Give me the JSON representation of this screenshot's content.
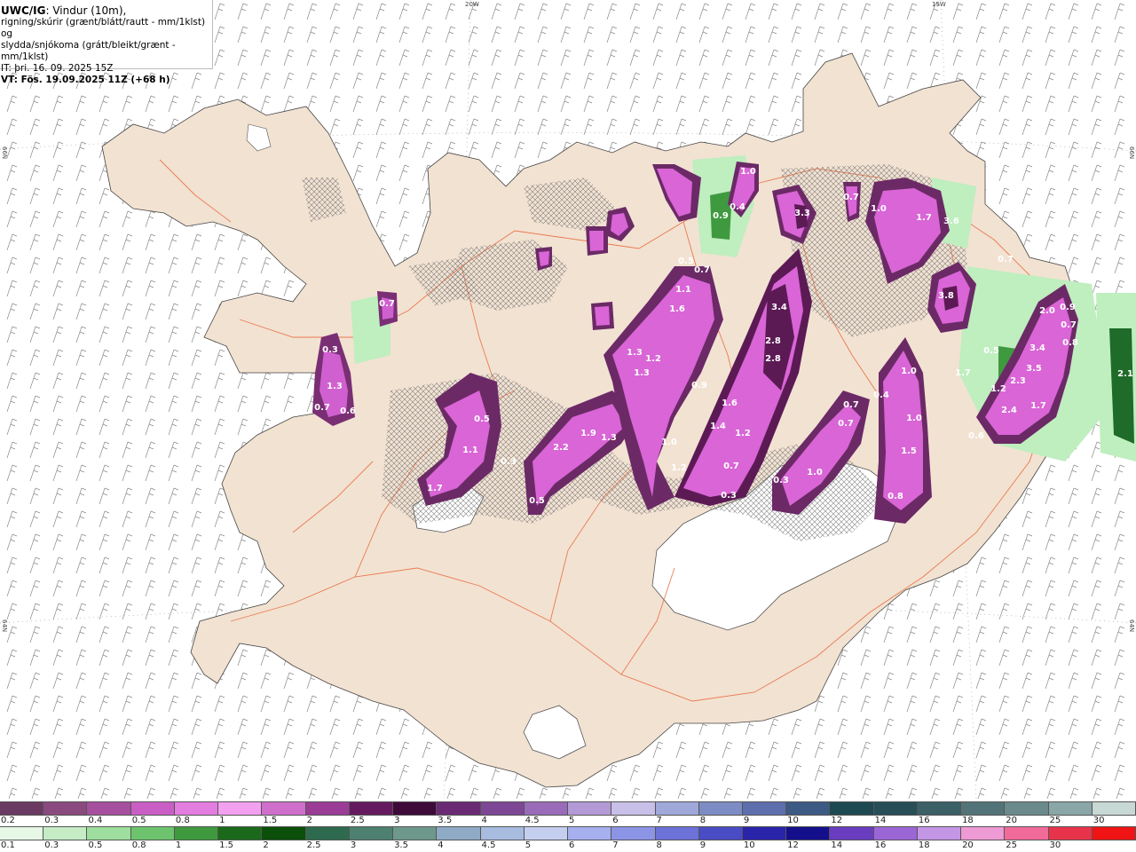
{
  "title": {
    "line1_bold": "UWC/IG",
    "line1_rest": ": Vindur (10m),",
    "line2": "rigning/skúrir (grænt/blátt/rautt - mm/1klst) og",
    "line3": "slydda/snjókoma (grátt/bleikt/grænt - mm/1klst)",
    "line4": "IT: þri. 16. 09. 2025 15Z",
    "line5": "VT: Fös. 19.09.2025 11Z (+68 h)"
  },
  "coords": {
    "top_left": "20W",
    "top_right": "15W",
    "left_upper": "66N",
    "left_lower": "64N",
    "right_upper": "66N",
    "right_lower": "64N"
  },
  "colors": {
    "land": "#f2e2d2",
    "sea": "#ffffff",
    "roads": "#e8683a",
    "glacier": "#ffffff",
    "snow_dark": "#5c1a55",
    "snow_mid": "#b540b0",
    "snow_light": "#ee88ee",
    "rain_green": "#a8e8a8",
    "rain_dark_green": "#1f6b2a"
  },
  "precip_values": [
    {
      "label": "0.7"
    },
    {
      "label": "0.3"
    },
    {
      "label": "1.3"
    },
    {
      "label": "0.7"
    },
    {
      "label": "0.6"
    },
    {
      "label": "0.5"
    },
    {
      "label": "1.1"
    },
    {
      "label": "1.7"
    },
    {
      "label": "0.3"
    },
    {
      "label": "0.5"
    },
    {
      "label": "2.2"
    },
    {
      "label": "1.9"
    },
    {
      "label": "1.3"
    },
    {
      "label": "1.3"
    },
    {
      "label": "1.2"
    },
    {
      "label": "1.3"
    },
    {
      "label": "1.1"
    },
    {
      "label": "1.6"
    },
    {
      "label": "0.7"
    },
    {
      "label": "0.5"
    },
    {
      "label": "0.9"
    },
    {
      "label": "1.0"
    },
    {
      "label": "1.2"
    },
    {
      "label": "1.6"
    },
    {
      "label": "1.4"
    },
    {
      "label": "1.2"
    },
    {
      "label": "0.7"
    },
    {
      "label": "0.3"
    },
    {
      "label": "3.4"
    },
    {
      "label": "2.8"
    },
    {
      "label": "2.8"
    },
    {
      "label": "0.3"
    },
    {
      "label": "1.0"
    },
    {
      "label": "0.7"
    },
    {
      "label": "0.7"
    },
    {
      "label": "0.4"
    },
    {
      "label": "1.0"
    },
    {
      "label": "1.0"
    },
    {
      "label": "1.5"
    },
    {
      "label": "0.8"
    },
    {
      "label": "0.9"
    },
    {
      "label": "0.4"
    },
    {
      "label": "1.0"
    },
    {
      "label": "3.3"
    },
    {
      "label": "0.7"
    },
    {
      "label": "1.0"
    },
    {
      "label": "1.7"
    },
    {
      "label": "3.6"
    },
    {
      "label": "3.8"
    },
    {
      "label": "0.7"
    },
    {
      "label": "2.0"
    },
    {
      "label": "3.4"
    },
    {
      "label": "3.5"
    },
    {
      "label": "2.3"
    },
    {
      "label": "2.4"
    },
    {
      "label": "1.7"
    },
    {
      "label": "1.2"
    },
    {
      "label": "0.6"
    },
    {
      "label": "2.1"
    },
    {
      "label": "0.8"
    },
    {
      "label": "0.9"
    },
    {
      "label": "1.7"
    },
    {
      "label": "0.7"
    },
    {
      "label": "0.5"
    }
  ],
  "legend_snow": {
    "labels": [
      "0.2",
      "0.3",
      "0.4",
      "0.5",
      "0.8",
      "1",
      "1.5",
      "2",
      "2.5",
      "3",
      "3.5",
      "4",
      "4.5",
      "5",
      "6",
      "7",
      "8",
      "9",
      "10",
      "12",
      "14",
      "16",
      "18",
      "20",
      "25",
      "30"
    ],
    "colors": [
      "#6b3a63",
      "#8a4a80",
      "#a64f9e",
      "#c95fc4",
      "#e37de0",
      "#f3a0f0",
      "#cf6fcb",
      "#9b3c96",
      "#651a60",
      "#3d0a3a",
      "#6a2b74",
      "#7e4796",
      "#9a6bb8",
      "#b39ad6",
      "#c8c0e8",
      "#9fa8d8",
      "#7d8cc4",
      "#5e6fae",
      "#3c5a84",
      "#1d4a52",
      "#284e58",
      "#3b6066",
      "#527478",
      "#6a8a8c",
      "#8aa6a6",
      "#c8d8d4"
    ]
  },
  "legend_rain": {
    "labels": [
      "0.1",
      "0.3",
      "0.5",
      "0.8",
      "1",
      "1.5",
      "2",
      "2.5",
      "3",
      "3.5",
      "4",
      "4.5",
      "5",
      "6",
      "7",
      "8",
      "9",
      "10",
      "12",
      "14",
      "16",
      "18",
      "20",
      "25",
      "30"
    ],
    "colors": [
      "#e6f7e6",
      "#c5ecc5",
      "#9ede9e",
      "#6ec46e",
      "#3f9a3f",
      "#1b6a1b",
      "#0b4f0b",
      "#2e6a4e",
      "#4d8070",
      "#6e988c",
      "#8eaac4",
      "#a8bce0",
      "#c4cff0",
      "#a6b0ee",
      "#8c94e6",
      "#6c72d8",
      "#4a4cc4",
      "#2a24aa",
      "#14108c",
      "#6a3cc0",
      "#9a66d6",
      "#c496e6",
      "#ee9ad4",
      "#f06a9a",
      "#e8344a",
      "#f01414"
    ]
  }
}
